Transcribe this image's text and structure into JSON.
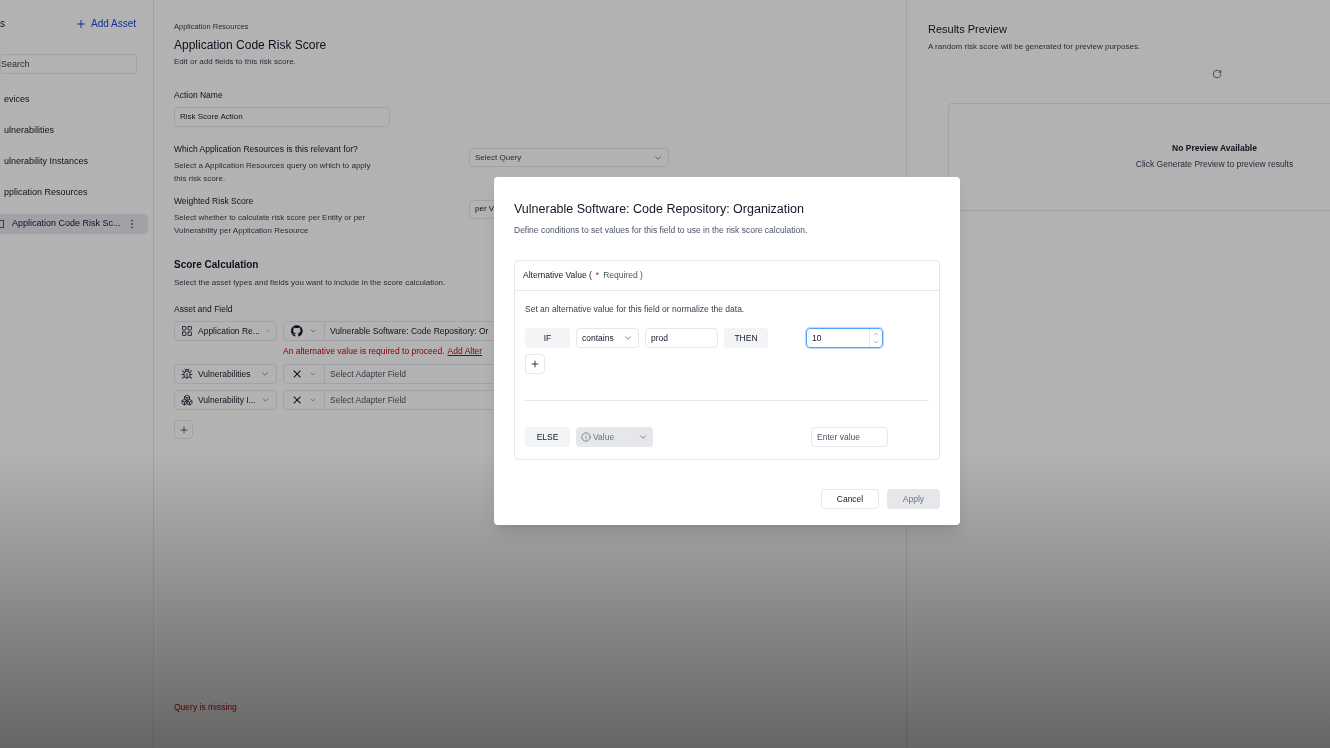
{
  "sidebar": {
    "header": "s",
    "add_button": "Add Asset",
    "search": {
      "placeholder": "Search"
    },
    "items": [
      {
        "label": "evices",
        "selected": false,
        "icon": false
      },
      {
        "label": "ulnerabilities",
        "selected": false,
        "icon": false
      },
      {
        "label": "ulnerability Instances",
        "selected": false,
        "icon": false
      },
      {
        "label": "pplication Resources",
        "selected": false,
        "icon": false
      },
      {
        "label": "Application Code Risk Sc...",
        "selected": true,
        "icon": true
      }
    ]
  },
  "main": {
    "breadcrumb": "Application Resources",
    "title": "Application Code Risk Score",
    "subtitle": "Edit or add fields to this risk score.",
    "action_name": {
      "label": "Action Name",
      "value": "Risk Score Action"
    },
    "relevance": {
      "label": "Which Application Resources is this relevant for?",
      "description": "Select a Application Resources query on which to apply this risk score.",
      "select_placeholder": "Select Query"
    },
    "weighted": {
      "label": "Weighted Risk Score",
      "description": "Select whether to calculate risk score per Entity or per Vulnerability per Application Resource",
      "select_value": "per V"
    },
    "score_calculation": {
      "title": "Score Calculation",
      "description": "Select the asset types and fields you want to include in the score calculation.",
      "field_label": "Asset and Field",
      "rows": [
        {
          "asset": {
            "label": "Application Re...",
            "kind": "grid"
          },
          "adapter": {
            "kind": "github"
          },
          "field": "Vulnerable Software: Code Repository: Or",
          "field_set": true,
          "error": {
            "text": "An alternative value is required to proceed.",
            "link": "Add Alter"
          }
        },
        {
          "asset": {
            "label": "Vulnerabilities",
            "kind": "bug"
          },
          "adapter": {
            "kind": "cross"
          },
          "field": "Select Adapter Field",
          "field_set": false
        },
        {
          "asset": {
            "label": "Vulnerability I...",
            "kind": "bug-group"
          },
          "adapter": {
            "kind": "cross"
          },
          "field": "Select Adapter Field",
          "field_set": false
        }
      ]
    },
    "footer_error": "Query is missing"
  },
  "results": {
    "title": "Results Preview",
    "description": "A random risk score will be generated for preview purposes.",
    "empty_title": "No Preview Available",
    "empty_text": "Click Generate Preview to preview results"
  },
  "modal": {
    "title": "Vulnerable Software: Code Repository: Organization",
    "description": "Define conditions to set values for this field to use in the risk score calculation.",
    "section_label": "Alternative Value (",
    "required_star": "*",
    "required_text": "Required )",
    "hint": "Set an alternative value for this field or normalize the data.",
    "conditions": [
      {
        "if_label": "IF",
        "operator": "contains",
        "value": "prod",
        "then_label": "THEN",
        "result": "10",
        "focused": true
      }
    ],
    "else": {
      "label": "ELSE",
      "select": "Value",
      "disabled": true,
      "placeholder": "Enter value"
    },
    "buttons": {
      "cancel": "Cancel",
      "apply": "Apply",
      "apply_disabled": true
    }
  }
}
